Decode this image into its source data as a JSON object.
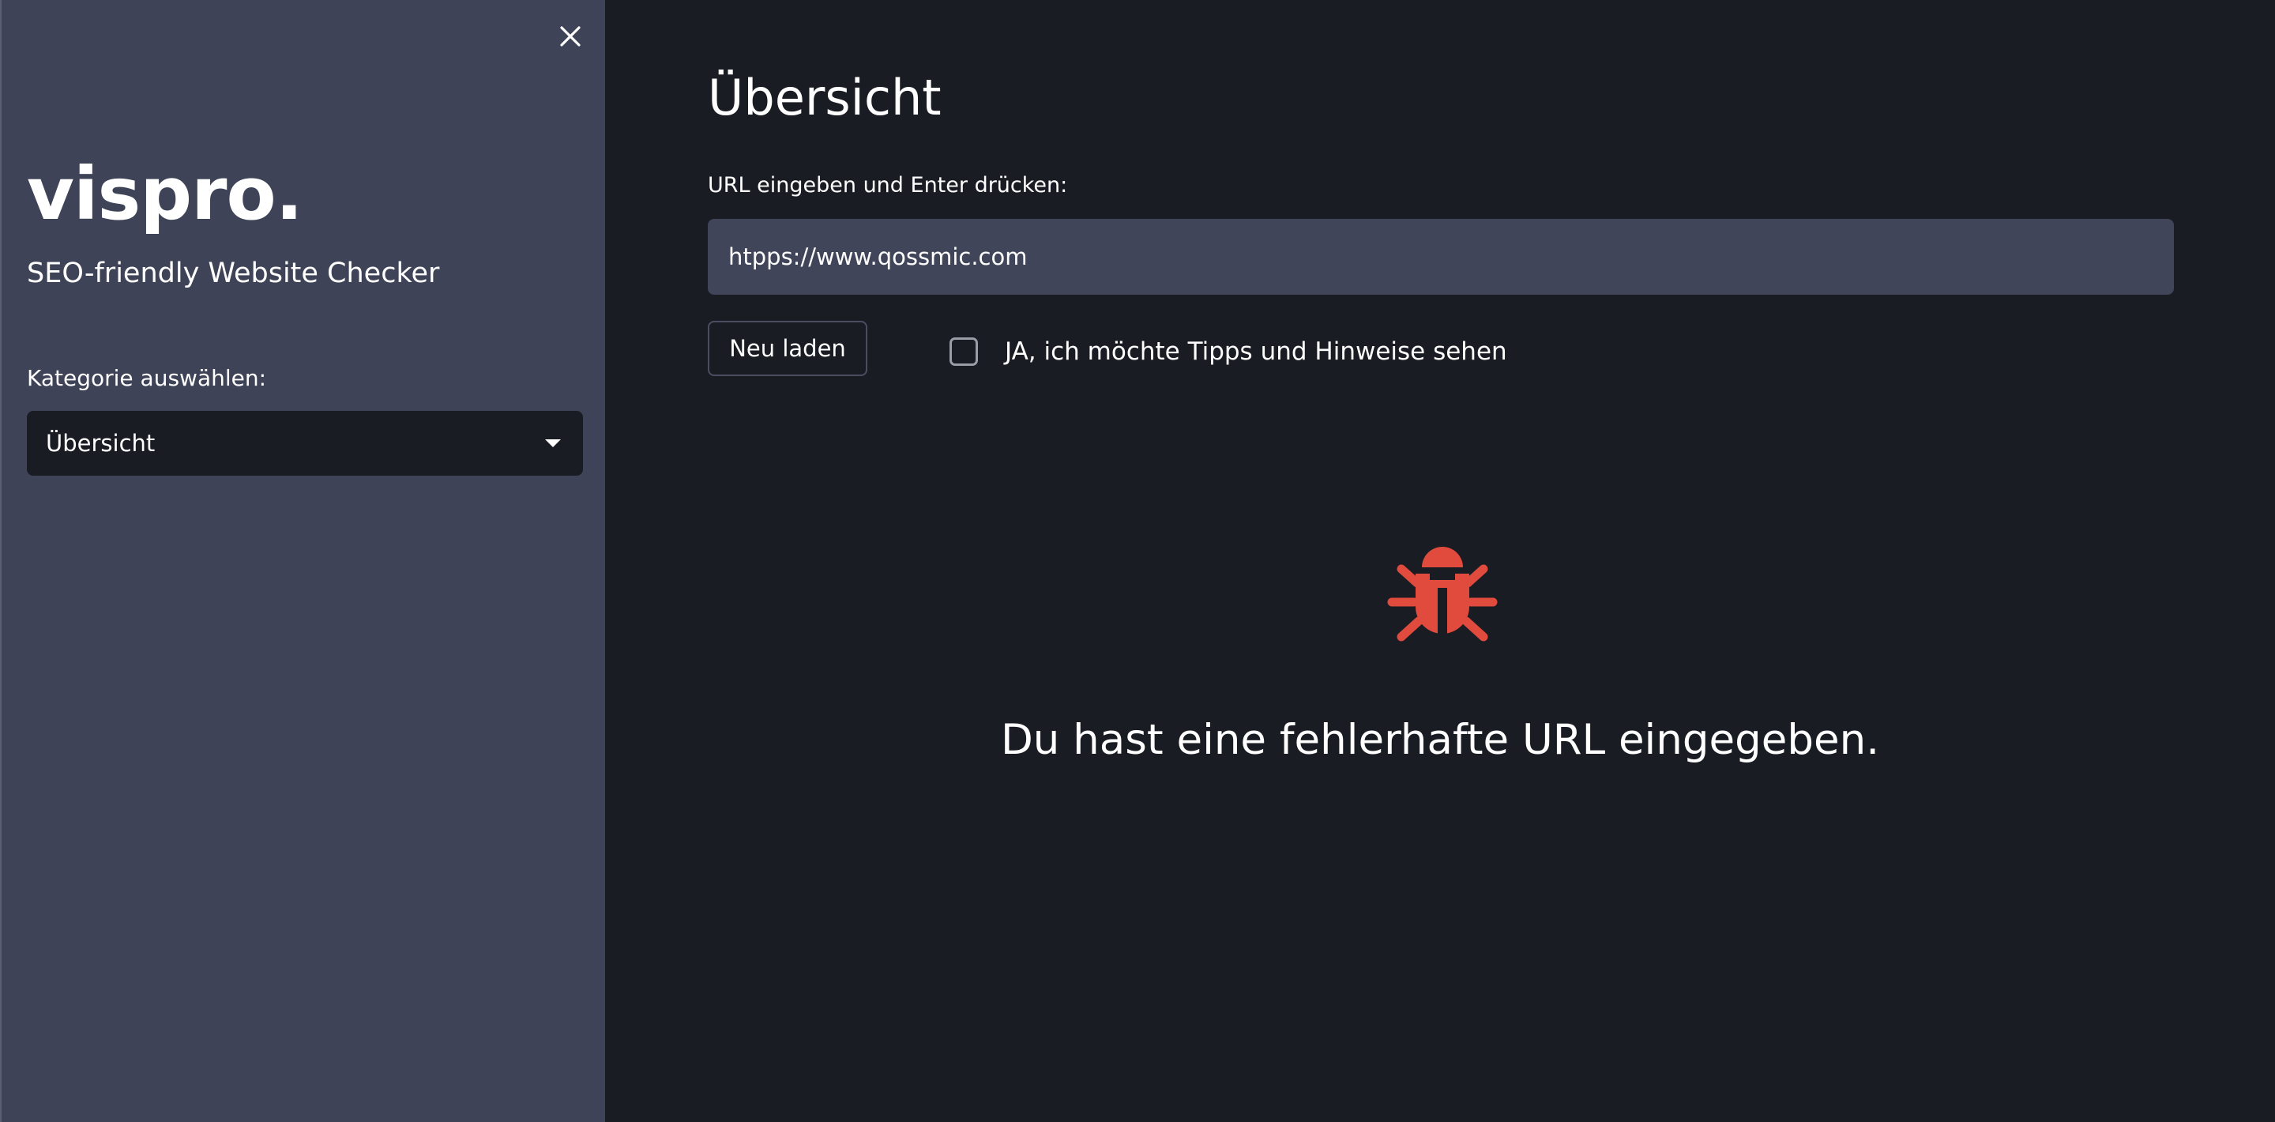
{
  "sidebar": {
    "brand_title": "vispro.",
    "brand_subtitle": "SEO-friendly Website Checker",
    "category_label": "Kategorie auswählen:",
    "category_selected": "Übersicht",
    "close_icon": "close-icon"
  },
  "main": {
    "page_title": "Übersicht",
    "url_label": "URL eingeben und Enter drücken:",
    "url_value": "htpps://www.qossmic.com",
    "reload_label": "Neu laden",
    "tips_checkbox_label": "JA, ich möchte Tipps und Hinweise sehen",
    "tips_checked": false,
    "error_icon": "bug-icon",
    "error_message": "Du hast eine fehlerhafte URL eingegeben."
  },
  "colors": {
    "sidebar_bg": "#3f4357",
    "main_bg": "#1a1c24",
    "input_bg": "#41455a",
    "error_icon": "#e04b3e"
  }
}
